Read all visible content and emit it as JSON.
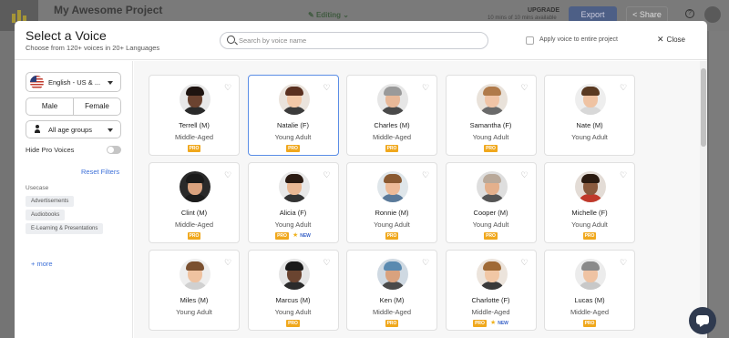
{
  "app": {
    "title": "My Awesome Project",
    "status": "Editing",
    "upgrade_label": "UPGRADE",
    "minutes_text": "10 mins of 10 mins available",
    "export_label": "Export",
    "share_label": "Share"
  },
  "modal": {
    "title": "Select a Voice",
    "subtitle": "Choose from 120+ voices in 20+ Languages",
    "search_placeholder": "Search by voice name",
    "apply_label": "Apply voice to entire project",
    "close_label": "Close"
  },
  "filters": {
    "language": "English - US & ...",
    "gender_male": "Male",
    "gender_female": "Female",
    "age": "All age groups",
    "hide_pro_label": "Hide Pro Voices",
    "hide_pro_enabled": false,
    "reset_label": "Reset Filters",
    "usecase_label": "Usecase",
    "usecases": [
      "Advertisements",
      "Audiobooks",
      "E-Learning & Presentations"
    ],
    "more_label": "+ more"
  },
  "voices": [
    {
      "name": "Terrell (M)",
      "age": "Middle-Aged",
      "pro": "PRO",
      "selected": false,
      "new": ""
    },
    {
      "name": "Natalie (F)",
      "age": "Young Adult",
      "pro": "PRO",
      "selected": true,
      "new": ""
    },
    {
      "name": "Charles (M)",
      "age": "Middle-Aged",
      "pro": "PRO",
      "selected": false,
      "new": ""
    },
    {
      "name": "Samantha (F)",
      "age": "Young Adult",
      "pro": "PRO",
      "selected": false,
      "new": ""
    },
    {
      "name": "Nate (M)",
      "age": "Young Adult",
      "pro": "",
      "selected": false,
      "new": ""
    },
    {
      "name": "Clint (M)",
      "age": "Middle-Aged",
      "pro": "PRO",
      "selected": false,
      "new": ""
    },
    {
      "name": "Alicia (F)",
      "age": "Young Adult",
      "pro": "PRO",
      "selected": false,
      "new": "NEW"
    },
    {
      "name": "Ronnie (M)",
      "age": "Young Adult",
      "pro": "PRO",
      "selected": false,
      "new": ""
    },
    {
      "name": "Cooper (M)",
      "age": "Young Adult",
      "pro": "PRO",
      "selected": false,
      "new": ""
    },
    {
      "name": "Michelle (F)",
      "age": "Young Adult",
      "pro": "PRO",
      "selected": false,
      "new": ""
    },
    {
      "name": "Miles (M)",
      "age": "Young Adult",
      "pro": "",
      "selected": false,
      "new": ""
    },
    {
      "name": "Marcus (M)",
      "age": "Young Adult",
      "pro": "PRO",
      "selected": false,
      "new": ""
    },
    {
      "name": "Ken (M)",
      "age": "Middle-Aged",
      "pro": "PRO",
      "selected": false,
      "new": ""
    },
    {
      "name": "Charlotte (F)",
      "age": "Middle-Aged",
      "pro": "PRO",
      "selected": false,
      "new": "NEW"
    },
    {
      "name": "Lucas (M)",
      "age": "Middle-Aged",
      "pro": "PRO",
      "selected": false,
      "new": ""
    }
  ],
  "colors": {
    "accent": "#3c6fd8",
    "pro_badge": "#f0a81d",
    "selected_border": "#5b8ee6"
  }
}
